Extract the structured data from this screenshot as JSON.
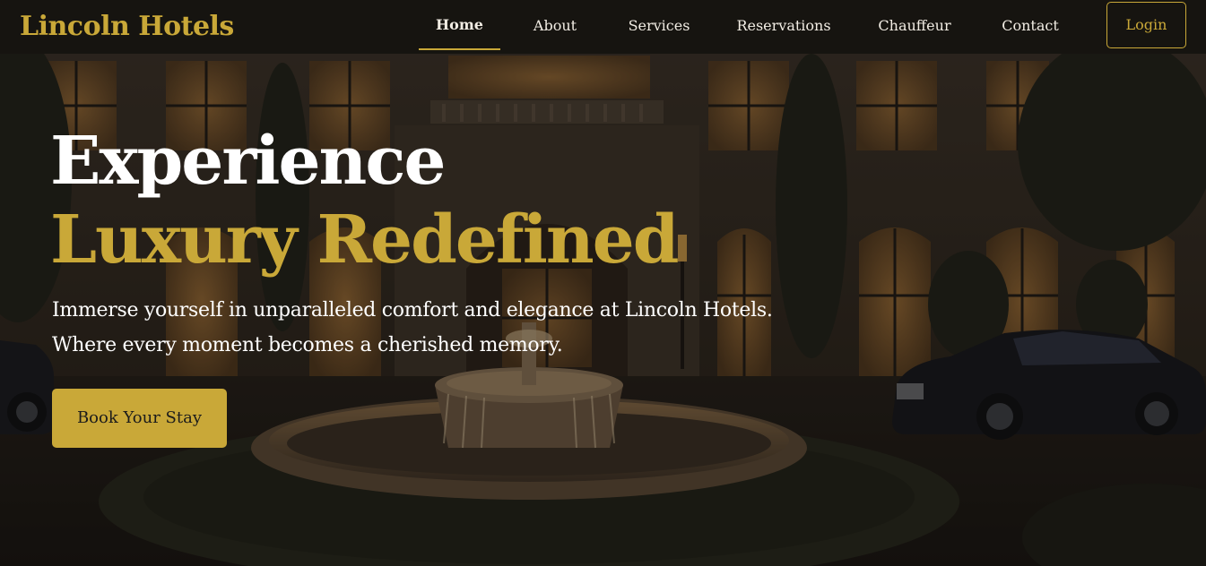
{
  "navbar": {
    "brand": "Lincoln Hotels",
    "links": [
      {
        "label": "Home",
        "active": true
      },
      {
        "label": "About",
        "active": false
      },
      {
        "label": "Services",
        "active": false
      },
      {
        "label": "Reservations",
        "active": false
      },
      {
        "label": "Chauffeur",
        "active": false
      },
      {
        "label": "Contact",
        "active": false
      }
    ],
    "login_label": "Login"
  },
  "hero": {
    "title_line_1": "Experience",
    "title_line_2": "Luxury Redefined",
    "subtitle_line_1": "Immerse yourself in unparalleled comfort and elegance at Lincoln Hotels.",
    "subtitle_line_2": "Where every moment becomes a cherished memory.",
    "cta_label": "Book Your Stay"
  },
  "colors": {
    "accent_gold": "#c9a838",
    "navbar_background": "#161310",
    "text_light": "#ffffff"
  }
}
